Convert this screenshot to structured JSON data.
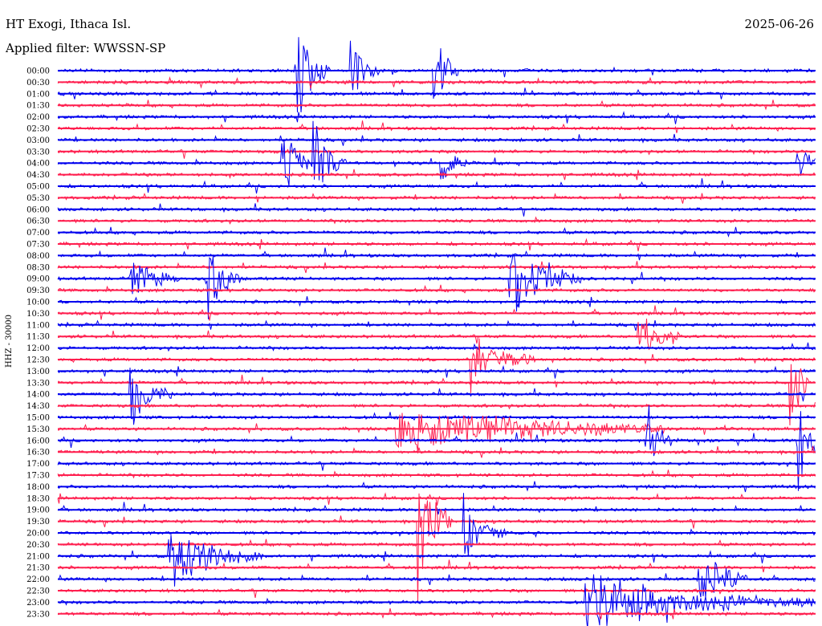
{
  "header": {
    "station": "HT Exogi, Ithaca Isl.",
    "date": "2025-06-26",
    "filter": "Applied filter: WWSSN-SP"
  },
  "chart_data": {
    "type": "line",
    "title": "HT Exogi, Ithaca Isl.",
    "subtitle": "Applied filter: WWSSN-SP",
    "date": "2025-06-26",
    "ylabel": "HHZ - 30000",
    "row_labels": [
      "00:00",
      "00:30",
      "01:00",
      "01:30",
      "02:00",
      "02:30",
      "03:00",
      "03:30",
      "04:00",
      "04:30",
      "05:00",
      "05:30",
      "06:00",
      "06:30",
      "07:00",
      "07:30",
      "08:00",
      "08:30",
      "09:00",
      "09:30",
      "10:00",
      "10:30",
      "11:00",
      "11:30",
      "12:00",
      "12:30",
      "13:00",
      "13:30",
      "14:00",
      "14:30",
      "15:00",
      "15:30",
      "16:00",
      "16:30",
      "17:00",
      "17:30",
      "18:00",
      "18:30",
      "19:00",
      "19:30",
      "20:00",
      "20:30",
      "21:00",
      "21:30",
      "22:00",
      "22:30",
      "23:00",
      "23:30"
    ],
    "colors": [
      "#0000ee",
      "#ff1f4f"
    ],
    "color_pattern": "alternating blue / red per 30-minute trace",
    "events": [
      {
        "row": "00:00",
        "x": 0.32,
        "w": 0.04,
        "amp": 4.5
      },
      {
        "row": "00:00",
        "x": 0.39,
        "w": 0.03,
        "amp": 3.5
      },
      {
        "row": "00:00",
        "x": 0.5,
        "w": 0.03,
        "amp": 3.0
      },
      {
        "row": "04:00",
        "x": 0.3,
        "w": 0.05,
        "amp": 2.5
      },
      {
        "row": "04:00",
        "x": 0.34,
        "w": 0.04,
        "amp": 3.5
      },
      {
        "row": "04:00",
        "x": 0.51,
        "w": 0.03,
        "amp": 2.0
      },
      {
        "row": "04:00",
        "x": 0.98,
        "w": 0.03,
        "amp": 2.0
      },
      {
        "row": "09:00",
        "x": 0.1,
        "w": 0.06,
        "amp": 2.0
      },
      {
        "row": "09:00",
        "x": 0.2,
        "w": 0.04,
        "amp": 3.0
      },
      {
        "row": "09:00",
        "x": 0.6,
        "w": 0.09,
        "amp": 3.5
      },
      {
        "row": "11:30",
        "x": 0.77,
        "w": 0.05,
        "amp": 2.0
      },
      {
        "row": "12:30",
        "x": 0.55,
        "w": 0.08,
        "amp": 2.5
      },
      {
        "row": "13:30",
        "x": 0.97,
        "w": 0.02,
        "amp": 5.0
      },
      {
        "row": "14:00",
        "x": 0.1,
        "w": 0.05,
        "amp": 3.0
      },
      {
        "row": "15:30",
        "x": 0.45,
        "w": 0.35,
        "amp": 2.5
      },
      {
        "row": "16:00",
        "x": 0.78,
        "w": 0.03,
        "amp": 3.0
      },
      {
        "row": "16:00",
        "x": 0.98,
        "w": 0.03,
        "amp": 5.0
      },
      {
        "row": "19:30",
        "x": 0.48,
        "w": 0.04,
        "amp": 5.5
      },
      {
        "row": "20:00",
        "x": 0.54,
        "w": 0.05,
        "amp": 3.0
      },
      {
        "row": "21:00",
        "x": 0.15,
        "w": 0.12,
        "amp": 3.0
      },
      {
        "row": "22:00",
        "x": 0.85,
        "w": 0.06,
        "amp": 3.0
      },
      {
        "row": "23:00",
        "x": 0.7,
        "w": 0.3,
        "amp": 2.5
      }
    ]
  }
}
